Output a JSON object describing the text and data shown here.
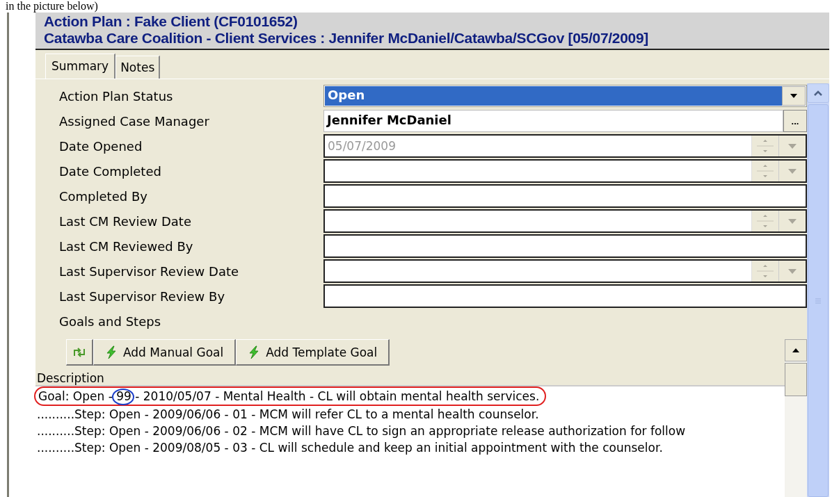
{
  "caption": "in the picture below)",
  "header": {
    "title": "Action Plan : Fake Client (CF0101652)",
    "subtitle": "Catawba Care Coalition - Client Services : Jennifer McDaniel/Catawba/SCGov [05/07/2009]"
  },
  "tabs": [
    {
      "label": "Summary",
      "selected": true
    },
    {
      "label": "Notes",
      "selected": false
    }
  ],
  "fields": [
    {
      "label": "Action Plan Status",
      "kind": "combo",
      "value": "Open"
    },
    {
      "label": "Assigned Case Manager",
      "kind": "lookup",
      "value": "Jennifer McDaniel",
      "button": "..."
    },
    {
      "label": "Date Opened",
      "kind": "date",
      "value": "05/07/2009",
      "disabled": true
    },
    {
      "label": "Date Completed",
      "kind": "date"
    },
    {
      "label": "Completed By",
      "kind": "text"
    },
    {
      "label": "Last CM Review Date",
      "kind": "date"
    },
    {
      "label": "Last CM Reviewed By",
      "kind": "text"
    },
    {
      "label": "Last Supervisor Review Date",
      "kind": "date"
    },
    {
      "label": "Last Supervisor Review By",
      "kind": "text"
    }
  ],
  "goals": {
    "title": "Goals and Steps",
    "buttons": [
      {
        "kind": "refresh"
      },
      {
        "kind": "add",
        "label": "Add Manual Goal"
      },
      {
        "kind": "add",
        "label": "Add Template Goal"
      }
    ],
    "column": "Description",
    "rows": [
      "Goal: Open - 99 - 2010/05/07 - Mental Health - CL will obtain mental health services.",
      "..........Step: Open - 2009/06/06 - 01 - MCM will refer CL to a mental health counselor.",
      "..........Step: Open - 2009/06/06 - 02 - MCM will have CL to sign an appropriate release authorization for follow",
      "..........Step: Open - 2009/08/05 - 03 - CL will schedule and keep an initial appointment with the counselor."
    ]
  }
}
